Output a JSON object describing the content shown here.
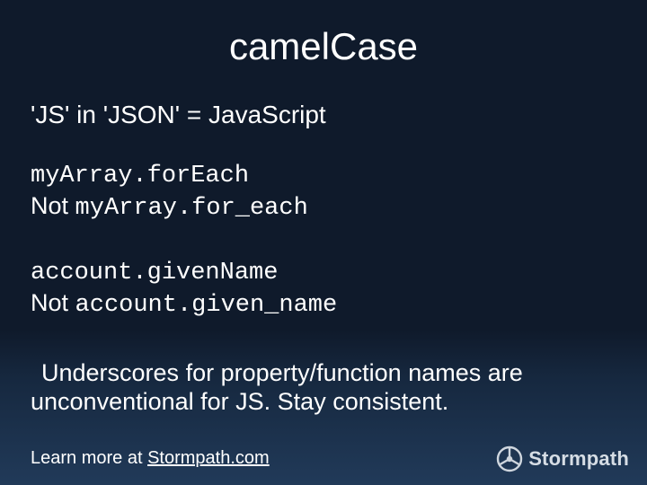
{
  "title": "camelCase",
  "subhead": "'JS' in 'JSON' = JavaScript",
  "example1": {
    "good": "myArray.forEach",
    "not_label": "Not",
    "bad": "myArray.for_each"
  },
  "example2": {
    "good": "account.givenName",
    "not_label": "Not",
    "bad": "account.given_name"
  },
  "paragraph": {
    "line1": "Underscores for property/function names are",
    "line2": "unconventional for JS.  Stay consistent."
  },
  "footer": {
    "prefix": "Learn more at ",
    "link_text": "Stormpath.com"
  },
  "brand": "Stormpath"
}
